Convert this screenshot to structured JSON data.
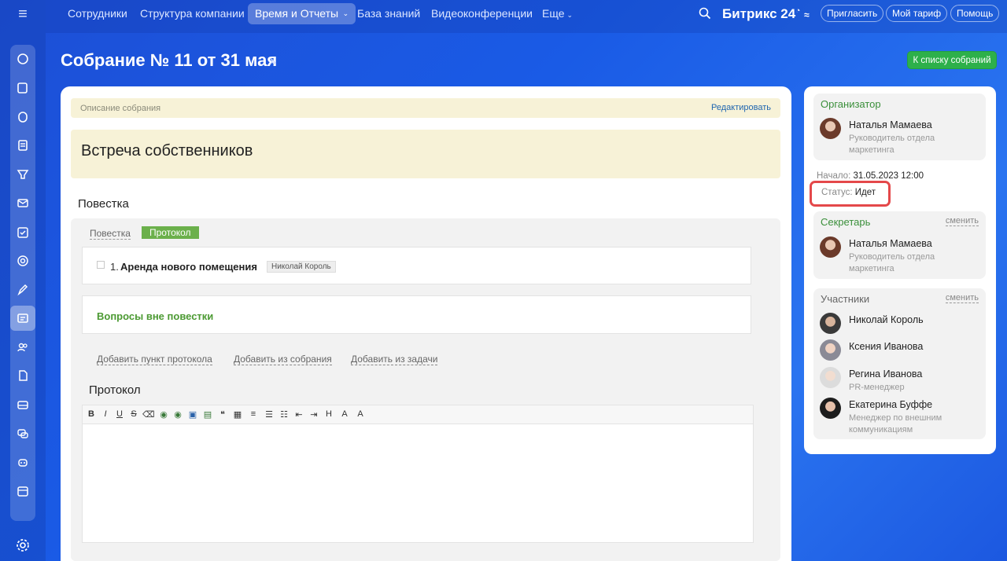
{
  "nav": {
    "items": [
      {
        "label": "Сотрудники"
      },
      {
        "label": "Структура компании"
      },
      {
        "label": "Время и Отчеты"
      },
      {
        "label": "База знаний"
      },
      {
        "label": "Видеоконференции"
      },
      {
        "label": "Еще"
      }
    ],
    "brand": "Битрикс 24",
    "invite": "Пригласить",
    "tariff": "Мой тариф",
    "help": "Помощь"
  },
  "header": {
    "title": "Собрание № 11 от 31 мая",
    "back_button": "К списку собраний"
  },
  "main": {
    "desc_label": "Описание собрания",
    "edit_label": "Редактировать",
    "meeting_title": "Встреча собственников",
    "agenda_heading": "Повестка",
    "tabs": {
      "agenda": "Повестка",
      "protocol": "Протокол"
    },
    "item": {
      "num": "1.",
      "text": "Аренда нового помещения",
      "tag": "Николай Король"
    },
    "other_questions": "Вопросы вне повестки",
    "actions": {
      "add_point": "Добавить пункт протокола",
      "add_from_meeting": "Добавить из собрания",
      "add_from_task": "Добавить из задачи"
    },
    "protocol_heading": "Протокол"
  },
  "side": {
    "organizer": {
      "title": "Организатор",
      "name": "Наталья Мамаева",
      "role": "Руководитель отдела маркетинга"
    },
    "start_label": "Начало:",
    "start_value": "31.05.2023 12:00",
    "status_label": "Статус:",
    "status_value": "Идет",
    "secretary": {
      "title": "Секретарь",
      "change": "сменить",
      "name": "Наталья Мамаева",
      "role": "Руководитель отдела маркетинга"
    },
    "participants": {
      "title": "Участники",
      "change": "сменить",
      "people": [
        {
          "name": "Николай Король",
          "role": ""
        },
        {
          "name": "Ксения Иванова",
          "role": ""
        },
        {
          "name": "Регина Иванова",
          "role": "PR-менеджер"
        },
        {
          "name": "Екатерина Буффе",
          "role": "Менеджер по внешним коммуникациям"
        }
      ]
    }
  },
  "colors": {
    "accent_green": "#2db04a",
    "highlight": "#e4484a",
    "link": "#2066b0"
  }
}
